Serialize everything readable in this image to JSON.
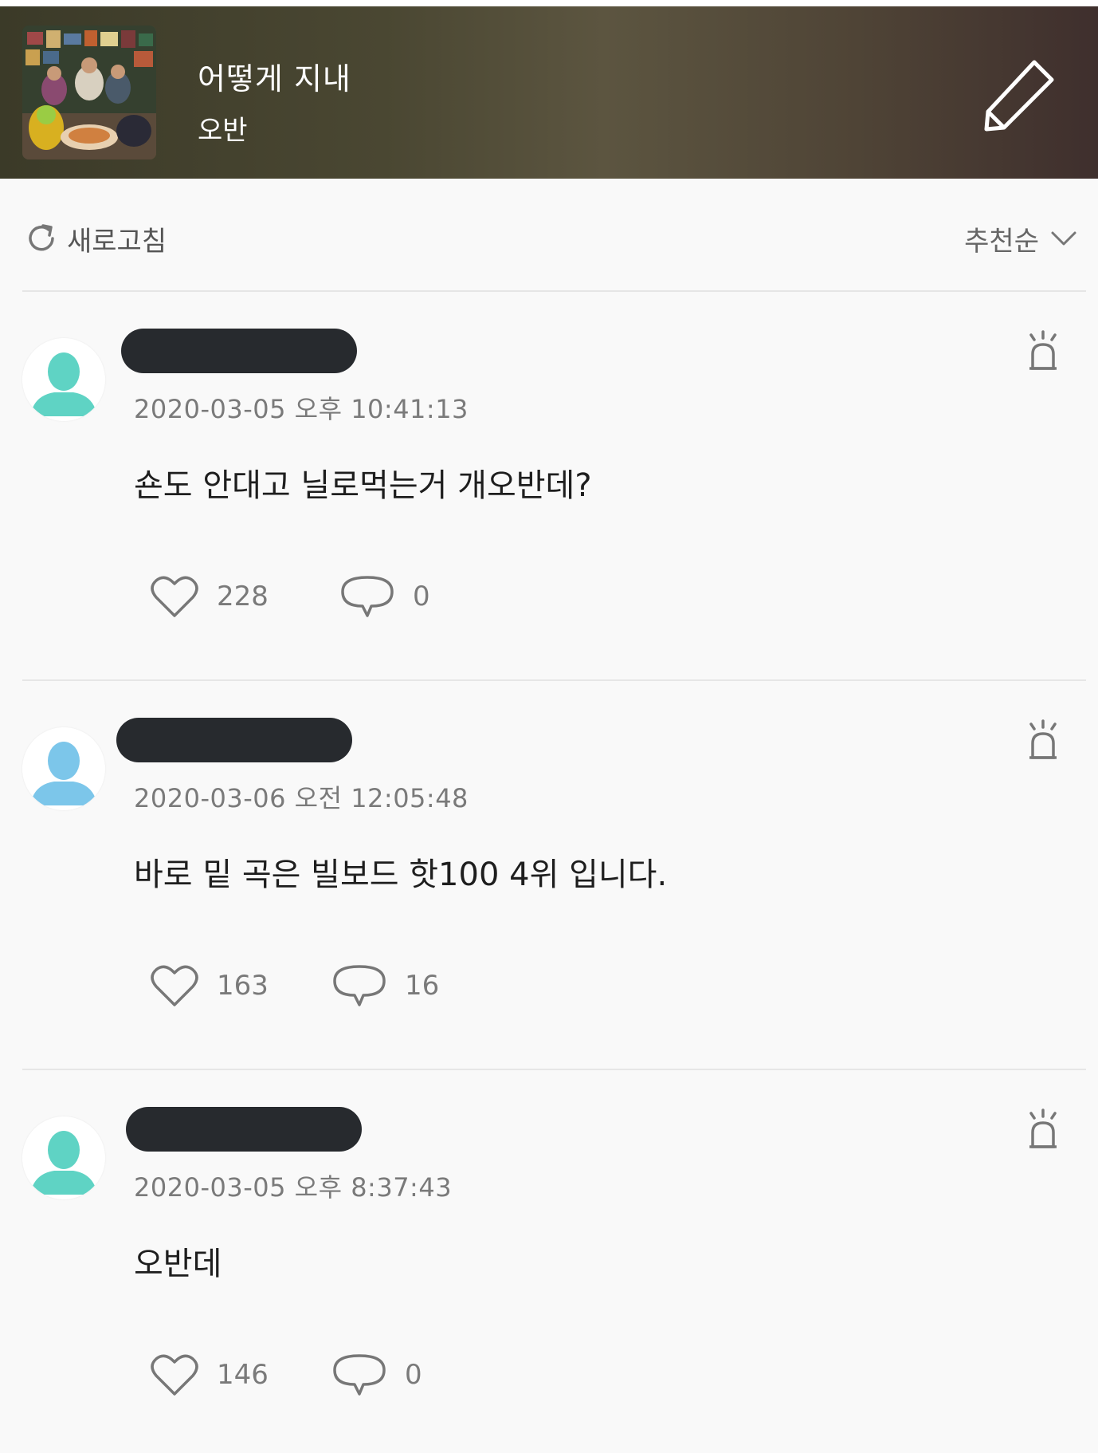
{
  "header": {
    "song_title": "어떻게 지내",
    "artist": "오반",
    "edit_icon": "pencil-icon"
  },
  "toolbar": {
    "refresh_label": "새로고침",
    "refresh_icon": "refresh-icon",
    "sort_label": "추천순",
    "sort_icon": "chevron-down-icon"
  },
  "comments": [
    {
      "timestamp": "2020-03-05 오후 10:41:13",
      "text": "숀도 안대고 닐로먹는거 개오반데?",
      "likes": "228",
      "replies": "0",
      "avatar_color": "#5fd3c4"
    },
    {
      "timestamp": "2020-03-06 오전 12:05:48",
      "text": "바로 밑 곡은 빌보드 핫100 4위 입니다.",
      "likes": "163",
      "replies": "16",
      "avatar_color": "#7cc6ea"
    },
    {
      "timestamp": "2020-03-05 오후 8:37:43",
      "text": "오반데",
      "likes": "146",
      "replies": "0",
      "avatar_color": "#5fd3c4"
    }
  ],
  "colors": {
    "redaction": "#272a2e",
    "muted_text": "#7a7a7a",
    "divider": "#e6e6e6"
  }
}
